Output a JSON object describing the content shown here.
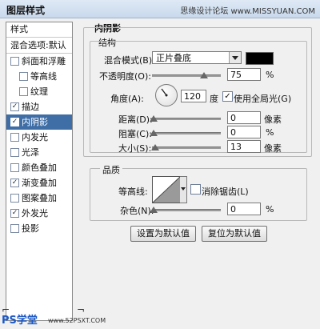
{
  "window": {
    "title": "图层样式",
    "watermark": "思缘设计论坛 www.MISSYUAN.COM"
  },
  "left_panel": {
    "header": "样式",
    "blend_options": "混合选项:默认",
    "items": [
      {
        "label": "斜面和浮雕",
        "checked": false,
        "indent": false
      },
      {
        "label": "等高线",
        "checked": false,
        "indent": true
      },
      {
        "label": "纹理",
        "checked": false,
        "indent": true
      },
      {
        "label": "描边",
        "checked": true,
        "indent": false
      },
      {
        "label": "内阴影",
        "checked": true,
        "indent": false,
        "selected": true
      },
      {
        "label": "内发光",
        "checked": false,
        "indent": false
      },
      {
        "label": "光泽",
        "checked": false,
        "indent": false
      },
      {
        "label": "颜色叠加",
        "checked": false,
        "indent": false
      },
      {
        "label": "渐变叠加",
        "checked": true,
        "indent": false
      },
      {
        "label": "图案叠加",
        "checked": false,
        "indent": false
      },
      {
        "label": "外发光",
        "checked": true,
        "indent": false
      },
      {
        "label": "投影",
        "checked": false,
        "indent": false
      }
    ]
  },
  "inner_shadow": {
    "section_title": "内阴影",
    "structure_title": "结构",
    "blend_mode_label": "混合模式(B):",
    "blend_mode_value": "正片叠底",
    "swatch_color": "#000000",
    "opacity_label": "不透明度(O):",
    "opacity_value": "75",
    "opacity_unit": "%",
    "angle_label": "角度(A):",
    "angle_value": "120",
    "angle_unit": "度",
    "global_light_label": "使用全局光(G)",
    "global_light_checked": true,
    "distance_label": "距离(D):",
    "distance_value": "0",
    "distance_unit": "像素",
    "choke_label": "阻塞(C):",
    "choke_value": "0",
    "choke_unit": "%",
    "size_label": "大小(S):",
    "size_value": "13",
    "size_unit": "像素",
    "quality_title": "品质",
    "contour_label": "等高线:",
    "antialias_label": "消除锯齿(L)",
    "antialias_checked": false,
    "noise_label": "杂色(N):",
    "noise_value": "0",
    "noise_unit": "%",
    "make_default_button": "设置为默认值",
    "reset_default_button": "复位为默认值"
  },
  "footer": {
    "ps_text": "PS学堂",
    "site": "www.52PSXT.COM"
  }
}
